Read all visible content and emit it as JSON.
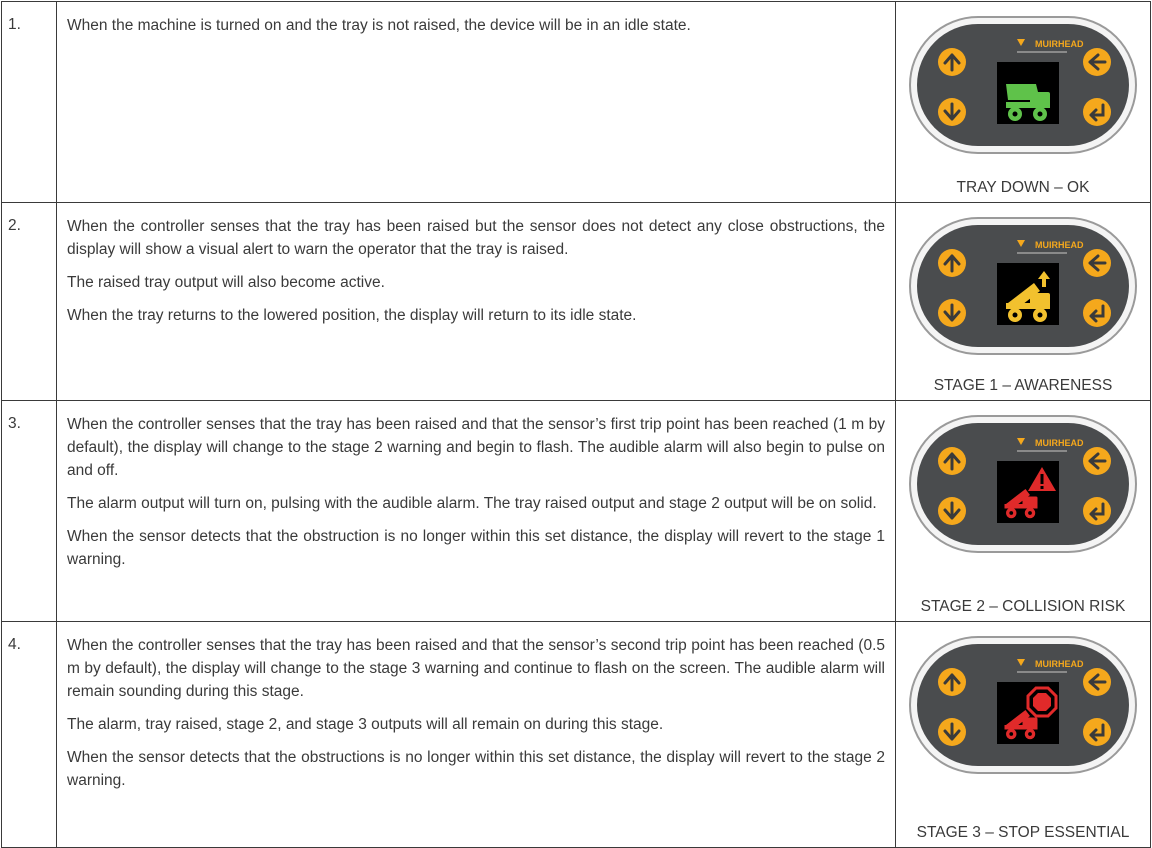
{
  "rows": [
    {
      "num": "1.",
      "paragraphs": [
        "When the machine is turned on and the tray is not raised, the device will be in an idle state."
      ],
      "caption": "TRAY DOWN – OK",
      "icon": "truck-ok-icon",
      "screen_color": "#5fc24a"
    },
    {
      "num": "2.",
      "paragraphs": [
        "When the controller senses that the tray has been raised but the sensor does not detect any close obstructions, the display will show a visual alert to warn the operator that the tray is raised.",
        "The raised tray output will also become active.",
        "When the tray returns to the lowered position, the display will return to its idle state."
      ],
      "caption": "STAGE 1 – AWARENESS",
      "icon": "truck-tray-raised-icon",
      "screen_color": "#f2c12e"
    },
    {
      "num": "3.",
      "paragraphs": [
        "When the controller senses that the tray has been raised and that the sensor’s first trip point has been reached (1 m by default), the display will change to the stage 2 warning and begin to flash. The audible alarm will also begin to pulse on and off.",
        "The alarm output will turn on, pulsing with the audible alarm. The tray raised output and stage 2 output will be on solid.",
        "When the sensor detects that the obstruction is no longer within this set distance, the display will revert to the stage 1 warning."
      ],
      "caption": "STAGE 2 – COLLISION RISK",
      "icon": "truck-warning-icon",
      "screen_color": "#e02a2a"
    },
    {
      "num": "4.",
      "paragraphs": [
        "When the controller senses that the tray has been raised and that the sensor’s second trip point has been reached (0.5 m by default), the display will change to the stage 3 warning and continue to flash on the screen. The audible alarm will remain sounding during this stage.",
        "The alarm, tray raised, stage 2, and stage 3 outputs will all remain on during this stage.",
        "When the sensor detects that the obstructions is no longer within this set distance, the display will revert to the stage 2 warning."
      ],
      "caption": "STAGE 3 – STOP ESSENTIAL",
      "icon": "truck-stop-icon",
      "screen_color": "#e02a2a"
    }
  ],
  "brand": "MUIRHEAD",
  "colors": {
    "panel_body": "#4a4c4e",
    "button": "#f5a81c",
    "border": "#3a3a3a"
  }
}
